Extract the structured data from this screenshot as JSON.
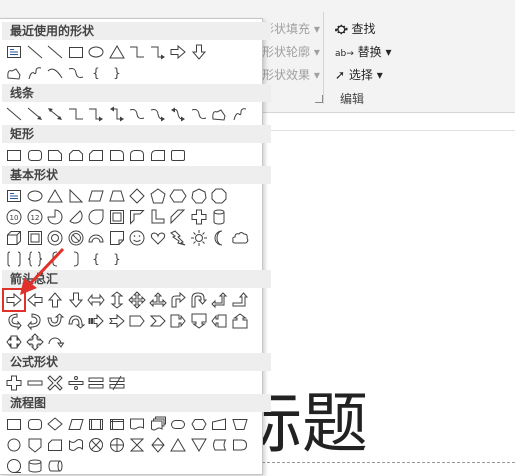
{
  "ribbon": {
    "shape_fill": "形状填充",
    "shape_outline": "形状轮廓",
    "shape_effects": "形状效果",
    "find": "查找",
    "replace": "替换",
    "select": "选择",
    "group_label": "编辑"
  },
  "slide": {
    "title_fragment": "标题"
  },
  "shapes_panel": {
    "categories": [
      {
        "label": "最近使用的形状",
        "rows": [
          [
            "textbox",
            "line",
            "line-diag",
            "rect",
            "oval",
            "triangle",
            "elbow",
            "elbow-arrow",
            "right-arrow",
            "down-arrow"
          ],
          [
            "freeform",
            "squiggle",
            "arc-curve",
            "curve",
            "brace-left",
            "brace-right"
          ]
        ]
      },
      {
        "label": "线条",
        "rows": [
          [
            "line",
            "line-arrow",
            "line-dbl-arrow",
            "elbow",
            "elbow-arrow",
            "elbow-dbl-arrow",
            "curve",
            "curve-arrow",
            "curve-dbl-arrow",
            "curve",
            "freeform",
            "squiggle"
          ]
        ]
      },
      {
        "label": "矩形",
        "rows": [
          [
            "rect",
            "round-rect",
            "snip1",
            "snip2",
            "snip3",
            "round1",
            "round2",
            "round3",
            "round4"
          ]
        ]
      },
      {
        "label": "基本形状",
        "rows": [
          [
            "textbox",
            "oval",
            "triangle",
            "right-triangle",
            "parallelogram",
            "trapezoid",
            "diamond",
            "pentagon",
            "hexagon",
            "heptagon",
            "octagon"
          ],
          [
            "decagon",
            "dodecagon",
            "pie",
            "chord",
            "teardrop",
            "frame",
            "half-frame",
            "l-shape",
            "diag-stripe",
            "plus",
            "can"
          ],
          [
            "cube",
            "bevel",
            "donut",
            "no-symbol",
            "block-arc",
            "folded",
            "smiley",
            "heart",
            "lightning",
            "sun",
            "moon",
            "cloud"
          ],
          [
            "bracket-pair",
            "brace-pair",
            "bracket-left",
            "bracket-right",
            "brace-left",
            "brace-right"
          ]
        ]
      },
      {
        "label": "箭头总汇",
        "rows": [
          [
            "right-arrow",
            "left-arrow",
            "up-arrow",
            "down-arrow",
            "left-right-arrow",
            "up-down-arrow",
            "quad-arrow",
            "left-right-up-arrow",
            "bent-arrow",
            "u-turn-arrow",
            "left-up-arrow",
            "bent-up-arrow"
          ],
          [
            "curved-right",
            "curved-left",
            "curved-up",
            "curved-down",
            "striped-right",
            "notched-right",
            "pentagon-arrow",
            "chevron",
            "right-callout",
            "down-callout",
            "left-callout",
            "up-callout"
          ],
          [
            "left-right-callout",
            "quad-callout",
            "circular-arrow"
          ]
        ]
      },
      {
        "label": "公式形状",
        "rows": [
          [
            "plus",
            "minus",
            "multiply",
            "divide",
            "equal",
            "not-equal"
          ]
        ]
      },
      {
        "label": "流程图",
        "rows": [
          [
            "process",
            "alt-process",
            "decision",
            "data",
            "predefined",
            "internal",
            "document",
            "multidoc",
            "terminator",
            "preparation",
            "manual-input",
            "manual-op"
          ],
          [
            "connector",
            "offpage",
            "card",
            "punched-tape",
            "summing",
            "or",
            "collate",
            "sort",
            "extract",
            "merge",
            "stored-data",
            "delay"
          ],
          [
            "sequential",
            "magnetic-disk",
            "direct-access"
          ]
        ]
      }
    ]
  }
}
